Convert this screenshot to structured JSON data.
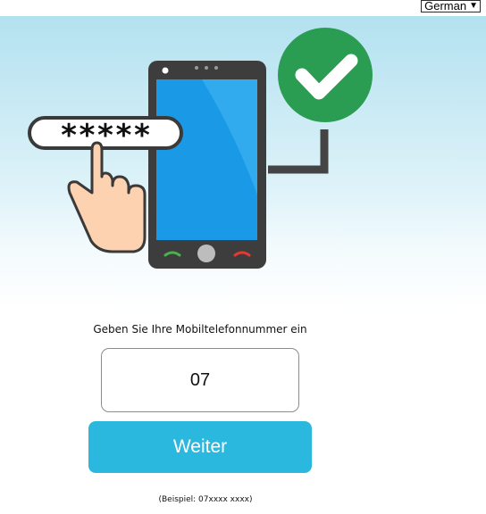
{
  "language_select": {
    "selected": "German"
  },
  "hero": {
    "pin_mask": "*****",
    "icons": [
      "hand-pointer-icon",
      "smartphone-icon",
      "checkmark-icon",
      "call-accept-icon",
      "call-decline-icon"
    ],
    "colors": {
      "check_circle": "#2a9d52",
      "phone_screen": "#1a9ae6",
      "phone_body": "#3d3d3d"
    }
  },
  "form": {
    "prompt": "Geben Sie Ihre Mobiltelefonnummer ein",
    "phone_value": "07",
    "submit_label": "Weiter",
    "example": "(Beispiel: 07xxxx xxxx)"
  },
  "colors": {
    "button_bg": "#2ab8de",
    "button_text": "#ffffff"
  }
}
